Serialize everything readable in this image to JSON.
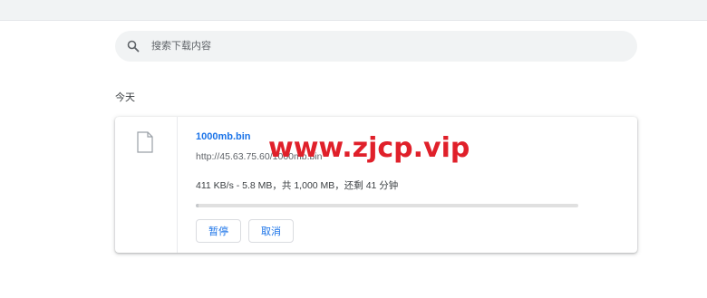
{
  "search": {
    "placeholder": "搜索下载内容",
    "icon": "search-icon"
  },
  "section": {
    "date_label": "今天"
  },
  "download": {
    "file_icon": "file-icon",
    "filename": "1000mb.bin",
    "url": "http://45.63.75.60/1000mb.bin",
    "status": "411 KB/s - 5.8 MB，共 1,000 MB，还剩 41 分钟",
    "progress_fraction": 0.006,
    "pause_label": "暂停",
    "cancel_label": "取消"
  },
  "watermark": {
    "text": "www.zjcp.vip"
  },
  "colors": {
    "link": "#1a73e8",
    "watermark": "#e0202a",
    "search_bg": "#f1f3f4"
  }
}
